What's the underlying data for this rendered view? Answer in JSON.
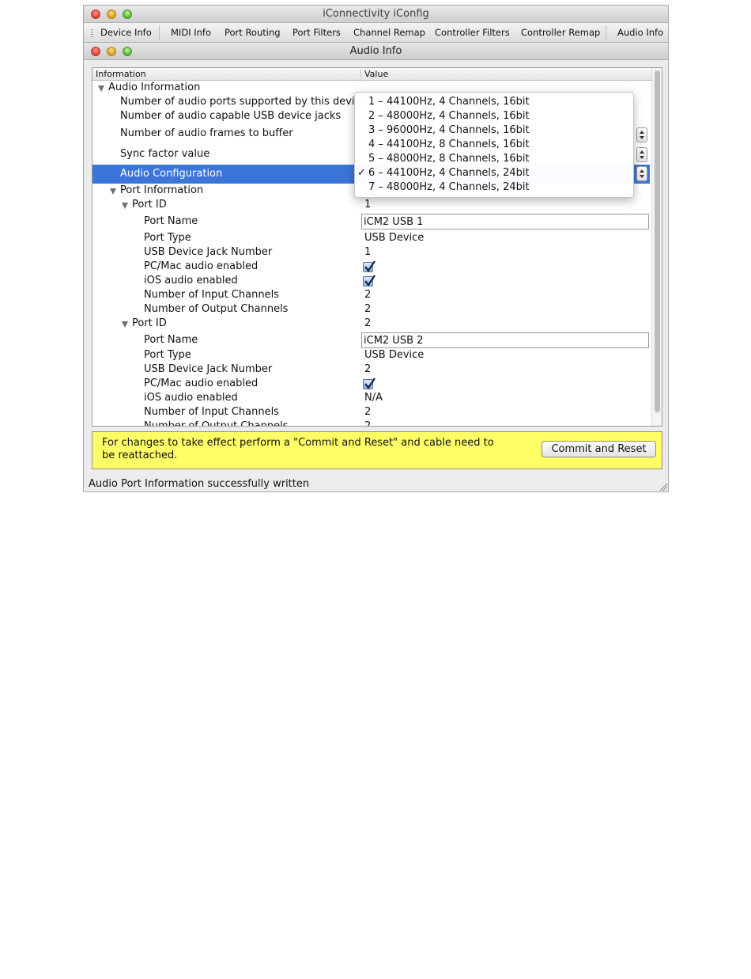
{
  "window": {
    "title": "iConnectivity iConfig"
  },
  "tabs": [
    "Device Info",
    "MIDI Info",
    "Port Routing",
    "Port Filters",
    "Channel Remap",
    "Controller Filters",
    "Controller Remap",
    "Audio Info"
  ],
  "panel": {
    "title": "Audio Info"
  },
  "table": {
    "headers": {
      "information": "Information",
      "value": "Value"
    },
    "audio_information": {
      "label": "Audio Information",
      "rows": [
        {
          "label": "Number of audio ports supported by this device",
          "value": ""
        },
        {
          "label": "Number of audio capable USB device jacks",
          "value": ""
        },
        {
          "label": "Number of audio frames to buffer",
          "value": ""
        },
        {
          "label": "Sync factor value",
          "value": ""
        },
        {
          "label": "Audio Configuration",
          "value": ""
        }
      ]
    },
    "port_information": {
      "label": "Port Information",
      "ports": [
        {
          "port_id_label": "Port ID",
          "port_id": "1",
          "port_name_label": "Port Name",
          "port_name": "iCM2 USB 1",
          "port_type_label": "Port Type",
          "port_type": "USB Device",
          "jack_label": "USB Device Jack Number",
          "jack": "1",
          "pcmac_label": "PC/Mac audio enabled",
          "pcmac_checked": true,
          "ios_label": "iOS audio enabled",
          "ios_checked": true,
          "ios_value": "",
          "inputs_label": "Number of Input Channels",
          "inputs": "2",
          "outputs_label": "Number of Output Channels",
          "outputs": "2"
        },
        {
          "port_id_label": "Port ID",
          "port_id": "2",
          "port_name_label": "Port Name",
          "port_name": "iCM2 USB 2",
          "port_type_label": "Port Type",
          "port_type": "USB Device",
          "jack_label": "USB Device Jack Number",
          "jack": "2",
          "pcmac_label": "PC/Mac audio enabled",
          "pcmac_checked": true,
          "ios_label": "iOS audio enabled",
          "ios_checked": false,
          "ios_value": "N/A",
          "inputs_label": "Number of Input Channels",
          "inputs": "2",
          "outputs_label": "Number of Output Channels",
          "outputs": "2"
        }
      ]
    }
  },
  "popup": {
    "selected_index": 5,
    "check_mark": "✓",
    "options": [
      "1 – 44100Hz, 4 Channels, 16bit",
      "2 – 48000Hz, 4 Channels, 16bit",
      "3 – 96000Hz, 4 Channels, 16bit",
      "4 – 44100Hz, 8 Channels, 16bit",
      "5 – 48000Hz, 8 Channels, 16bit",
      "6 – 44100Hz, 4 Channels, 24bit",
      "7 – 48000Hz, 4 Channels, 24bit"
    ]
  },
  "notice": {
    "text": "For changes to take effect perform a \"Commit and Reset\" and cable need to be reattached.",
    "button_label": "Commit and Reset",
    "background_color": "#ffff66"
  },
  "status": {
    "text": "Audio Port Information successfully written"
  },
  "colors": {
    "selection": "#3b75d9"
  },
  "icons": {
    "close": "close-icon",
    "minimize": "minimize-icon",
    "zoom": "zoom-icon",
    "disclosure": "disclosure-triangle-icon",
    "checkbox": "checkbox-checked-icon",
    "stepper": "stepper-arrows-icon",
    "resize": "resize-grip-icon"
  }
}
